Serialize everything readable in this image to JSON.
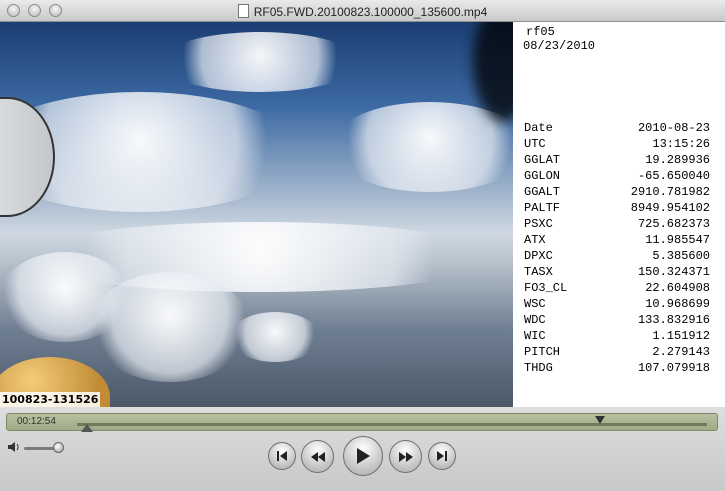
{
  "window": {
    "title": "RF05.FWD.20100823.100000_135600.mp4"
  },
  "video": {
    "timestamp_overlay": "100823-131526"
  },
  "info_panel": {
    "flight": "rf05",
    "date_header": "08/23/2010",
    "rows": [
      {
        "label": "Date",
        "value": "2010-08-23"
      },
      {
        "label": "UTC",
        "value": "13:15:26"
      },
      {
        "label": "GGLAT",
        "value": "19.289936"
      },
      {
        "label": "GGLON",
        "value": "-65.650040"
      },
      {
        "label": "GGALT",
        "value": "2910.781982"
      },
      {
        "label": "PALTF",
        "value": "8949.954102"
      },
      {
        "label": "PSXC",
        "value": "725.682373"
      },
      {
        "label": "ATX",
        "value": "11.985547"
      },
      {
        "label": "DPXC",
        "value": "5.385600"
      },
      {
        "label": "TASX",
        "value": "150.324371"
      },
      {
        "label": "FO3_CL",
        "value": "22.604908"
      },
      {
        "label": "WSC",
        "value": "10.968699"
      },
      {
        "label": "WDC",
        "value": "133.832916"
      },
      {
        "label": "WIC",
        "value": "1.151912"
      },
      {
        "label": "PITCH",
        "value": "2.279143"
      },
      {
        "label": "THDG",
        "value": "107.079918"
      }
    ]
  },
  "controls": {
    "elapsed": "00:12:54",
    "playhead_fraction": 0.83,
    "volume_fraction": 0.85,
    "icons": {
      "speaker": "speaker-icon",
      "previous": "skip-back-icon",
      "rewind": "rewind-icon",
      "play": "play-icon",
      "fast_forward": "fast-forward-icon",
      "next": "skip-forward-icon"
    }
  }
}
